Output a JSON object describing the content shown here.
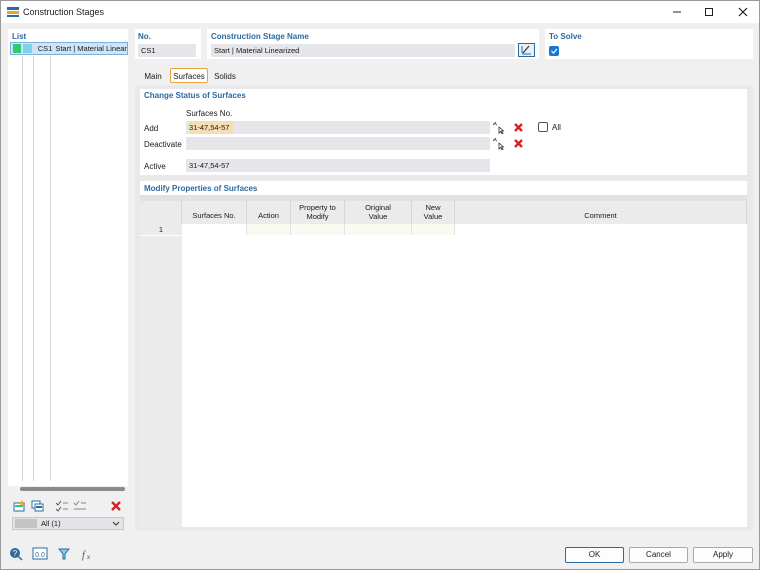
{
  "window": {
    "title": "Construction Stages"
  },
  "list_panel": {
    "title": "List",
    "items": [
      {
        "code": "CS1",
        "label": "Start | Material Lineariz"
      }
    ],
    "filter": "All (1)"
  },
  "no_panel": {
    "title": "No.",
    "value": "CS1"
  },
  "name_panel": {
    "title": "Construction Stage Name",
    "value": "Start | Material Linearized"
  },
  "solve_panel": {
    "title": "To Solve",
    "checked": true
  },
  "tabs": [
    {
      "label": "Main",
      "active": false
    },
    {
      "label": "Surfaces",
      "active": true
    },
    {
      "label": "Solids",
      "active": false
    }
  ],
  "change_status": {
    "title": "Change Status of Surfaces",
    "column_header": "Surfaces No.",
    "add_label": "Add",
    "add_value": "31-47,54-57",
    "deactivate_label": "Deactivate",
    "deactivate_value": "",
    "all_label": "All",
    "active_label": "Active",
    "active_value": "31-47,54-57"
  },
  "modify_props": {
    "title": "Modify Properties of Surfaces",
    "columns": [
      {
        "line1": "",
        "line2": "Surfaces No."
      },
      {
        "line1": "",
        "line2": "Action"
      },
      {
        "line1": "Property to",
        "line2": "Modify"
      },
      {
        "line1": "Original",
        "line2": "Value"
      },
      {
        "line1": "New",
        "line2": "Value"
      },
      {
        "line1": "",
        "line2": "Comment"
      }
    ],
    "rows": [
      {
        "num": "1"
      }
    ]
  },
  "buttons": {
    "ok": "OK",
    "cancel": "Cancel",
    "apply": "Apply"
  },
  "colors": {
    "accent": "#2c6aa0",
    "highlight": "#f5deb3",
    "tab_border": "#e8a33d"
  }
}
